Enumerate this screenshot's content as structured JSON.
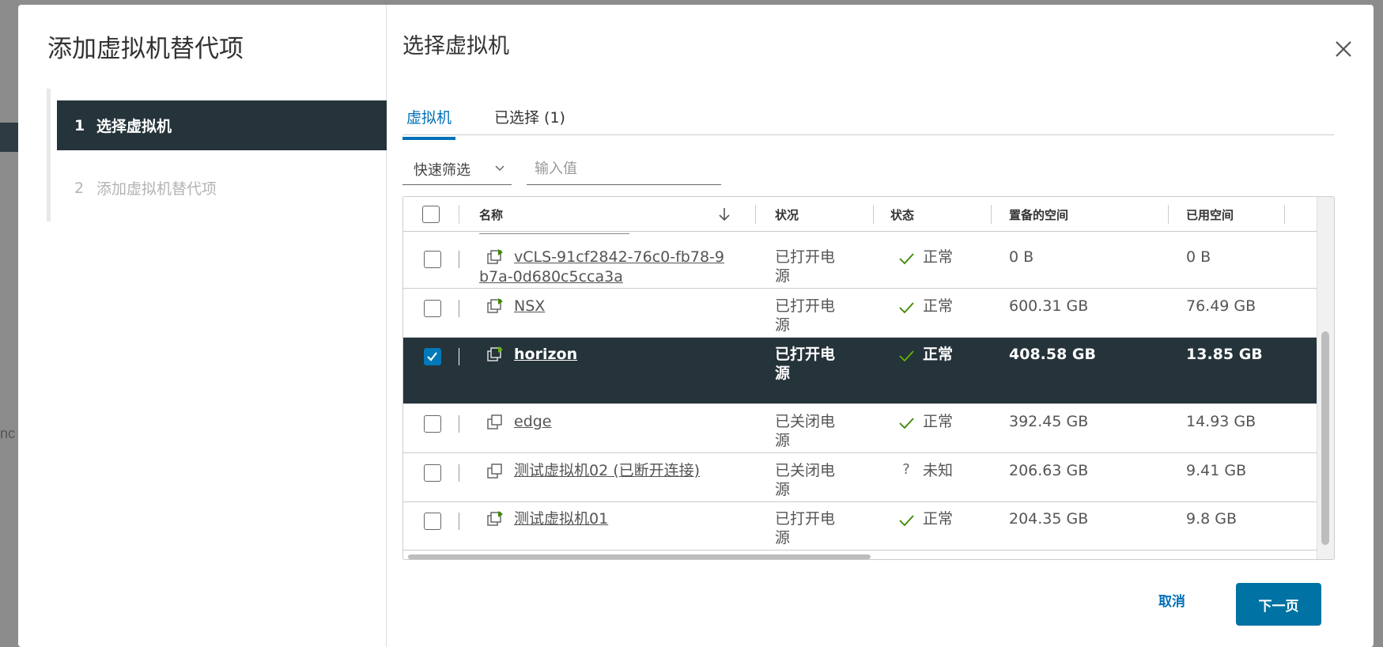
{
  "background": {
    "left_fragment": "nc"
  },
  "wizard": {
    "title": "添加虚拟机替代项",
    "steps": [
      {
        "num": "1",
        "label": "选择虚拟机",
        "active": true
      },
      {
        "num": "2",
        "label": "添加虚拟机替代项",
        "active": false
      }
    ]
  },
  "main": {
    "title": "选择虚拟机",
    "tabs": [
      {
        "label": "虚拟机",
        "active": true
      },
      {
        "label": "已选择 (1)",
        "active": false
      }
    ],
    "filter": {
      "quick_filter_label": "快速筛选",
      "input_placeholder": "输入值"
    }
  },
  "table": {
    "columns": [
      "名称",
      "状况",
      "状态",
      "置备的空间",
      "已用空间"
    ],
    "rows": [
      {
        "name": "vCLS-91cf2842-76c0-fb78-9b7a-0d680c5cca3a",
        "name_line1": "vCLS-91cf2842-76c0-fb78-9",
        "name_line2": "b7a-0d680c5cca3a",
        "power_line1": "已打开电",
        "power_line2": "源",
        "status_icon": "check-icon",
        "status": "正常",
        "provisioned": "0 B",
        "used": "0 B",
        "selected": false,
        "powered_on": true
      },
      {
        "name": "NSX",
        "power_line1": "已打开电",
        "power_line2": "源",
        "status_icon": "check-icon",
        "status": "正常",
        "provisioned": "600.31 GB",
        "used": "76.49 GB",
        "selected": false,
        "powered_on": true
      },
      {
        "name": "horizon",
        "power_line1": "已打开电",
        "power_line2": "源",
        "status_icon": "check-icon",
        "status": "正常",
        "provisioned": "408.58 GB",
        "used": "13.85 GB",
        "selected": true,
        "powered_on": true
      },
      {
        "name": "edge",
        "power_line1": "已关闭电",
        "power_line2": "源",
        "status_icon": "check-icon",
        "status": "正常",
        "provisioned": "392.45 GB",
        "used": "14.93 GB",
        "selected": false,
        "powered_on": false
      },
      {
        "name": "测试虚拟机02 (已断开连接)",
        "power_line1": "已关闭电",
        "power_line2": "源",
        "status_icon": "question-icon",
        "status": "未知",
        "provisioned": "206.63 GB",
        "used": "9.41 GB",
        "selected": false,
        "powered_on": false
      },
      {
        "name": "测试虚拟机01",
        "power_line1": "已打开电",
        "power_line2": "源",
        "status_icon": "check-icon",
        "status": "正常",
        "provisioned": "204.35 GB",
        "used": "9.8 GB",
        "selected": false,
        "powered_on": true
      }
    ]
  },
  "footer": {
    "cancel_label": "取消",
    "next_label": "下一页"
  },
  "colors": {
    "accent": "#0070b8",
    "selected_row": "#25333a",
    "check": "#3c8500",
    "primary_button": "#0072a3"
  }
}
